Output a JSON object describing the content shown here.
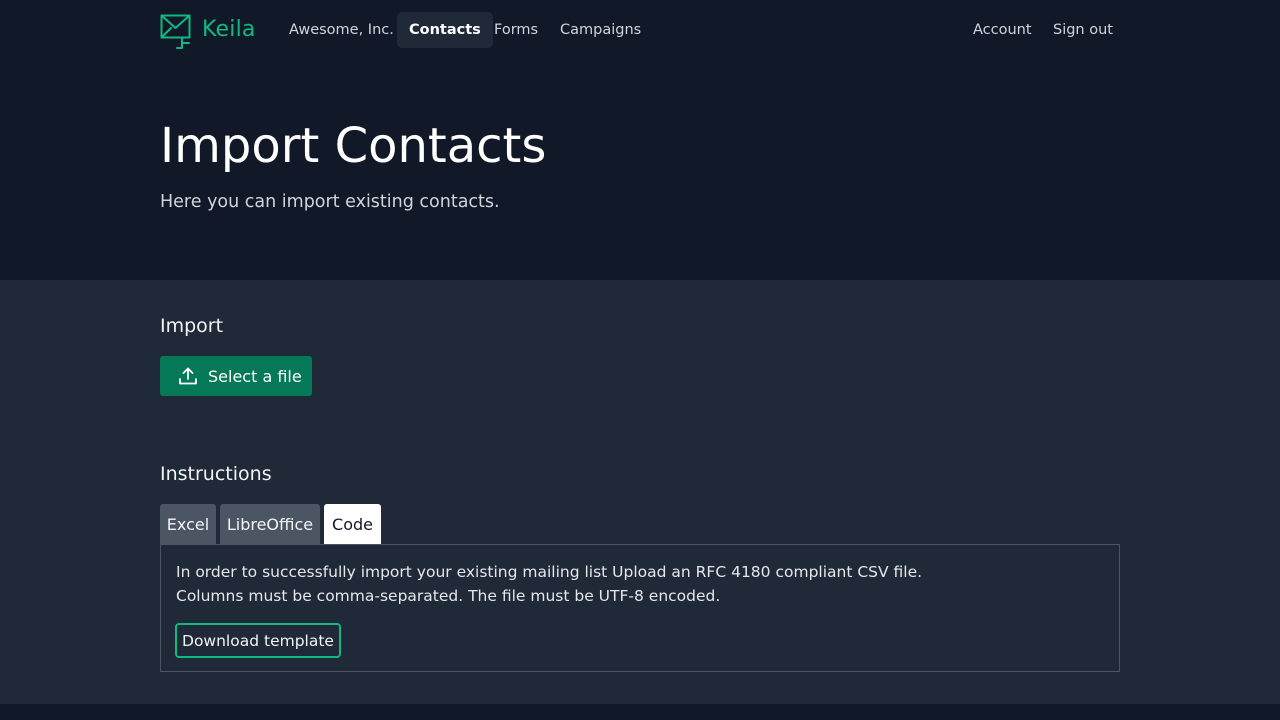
{
  "brand": {
    "name": "Keila",
    "icon": "envelope-icon",
    "color": "#10b981"
  },
  "nav": {
    "items": [
      {
        "label": "Awesome, Inc."
      },
      {
        "label": "Contacts",
        "active": true
      },
      {
        "label": "Forms"
      },
      {
        "label": "Campaigns"
      }
    ],
    "right": [
      {
        "label": "Account"
      },
      {
        "label": "Sign out"
      }
    ]
  },
  "page": {
    "title": "Import Contacts",
    "subtitle": "Here you can import existing contacts."
  },
  "import": {
    "heading": "Import",
    "select_button": {
      "label": "Select a file",
      "icon": "upload-icon"
    }
  },
  "instructions": {
    "heading": "Instructions",
    "tabs": [
      {
        "label": "Excel"
      },
      {
        "label": "LibreOffice"
      },
      {
        "label": "Code",
        "active": true
      }
    ],
    "text_line1": "In order to successfully import your existing mailing list Upload an RFC 4180 compliant CSV file.",
    "text_line2": "Columns must be comma-separated. The file must be UTF-8 encoded.",
    "download_label": "Download template"
  },
  "colors": {
    "background_dark": "#111827",
    "background_main": "#1f2937",
    "accent": "#10b981",
    "button_green": "#047857"
  }
}
